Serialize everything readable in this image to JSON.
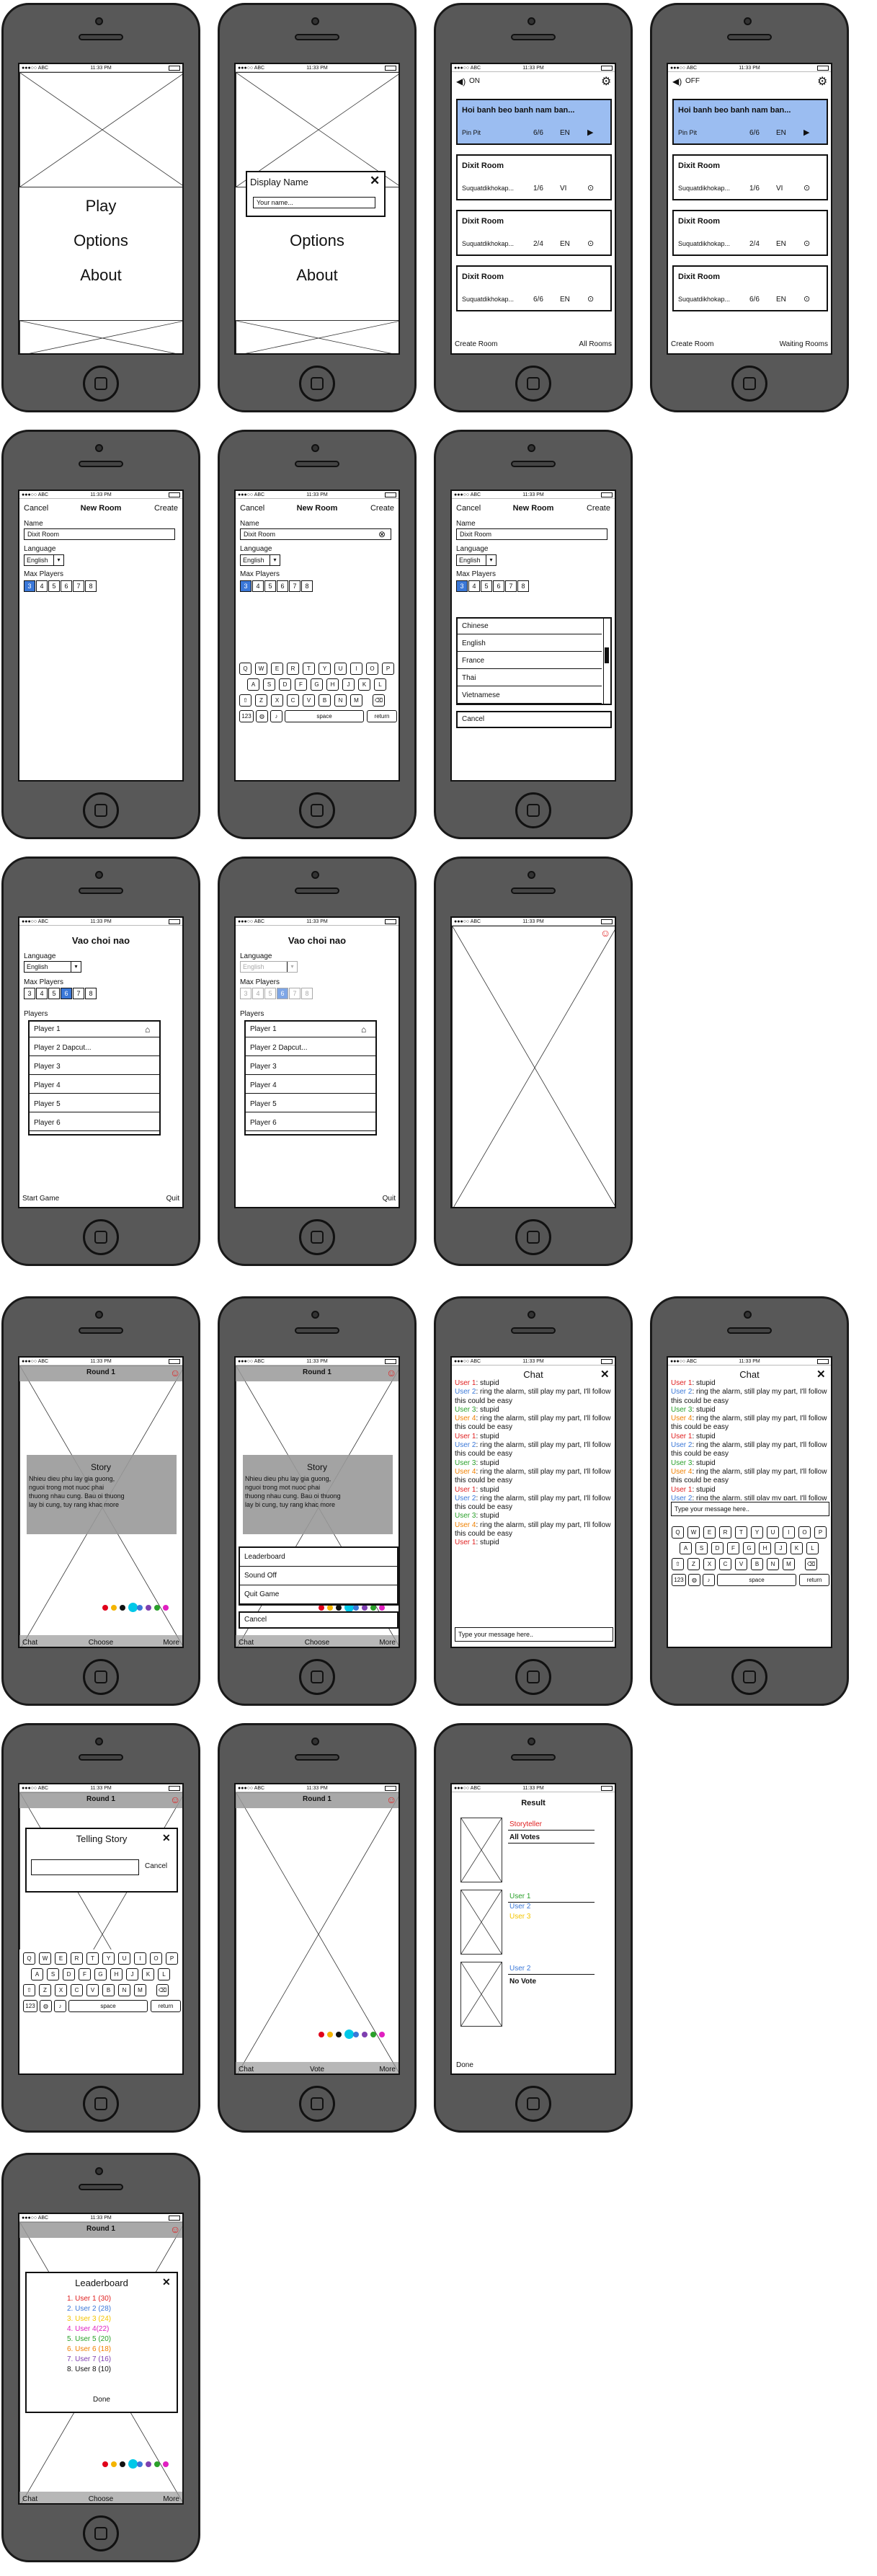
{
  "status": {
    "carrier": "●●●○○ ABC",
    "time": "11:33 PM"
  },
  "home": {
    "play": "Play",
    "options": "Options",
    "about": "About"
  },
  "display_name": {
    "title": "Display Name",
    "placeholder": "Your name..."
  },
  "rooms": {
    "sound_on": "ON",
    "sound_off": "OFF",
    "items": [
      {
        "name": "Hoi banh beo banh nam ban...",
        "owner": "Pin Pit",
        "count": "6/6",
        "lang": "EN",
        "state": "▶"
      },
      {
        "name": "Dixit Room",
        "owner": "Suquatdikhokap...",
        "count": "1/6",
        "lang": "VI",
        "state": "⊙"
      },
      {
        "name": "Dixit Room",
        "owner": "Suquatdikhokap...",
        "count": "2/4",
        "lang": "EN",
        "state": "⊙"
      },
      {
        "name": "Dixit Room",
        "owner": "Suquatdikhokap...",
        "count": "6/6",
        "lang": "EN",
        "state": "⊙"
      }
    ],
    "create_room": "Create Room",
    "all_rooms": "All Rooms",
    "waiting_rooms": "Waiting Rooms"
  },
  "new_room": {
    "cancel": "Cancel",
    "title": "New Room",
    "create": "Create",
    "name_label": "Name",
    "name_value": "Dixit Room",
    "language_label": "Language",
    "language_value": "English",
    "max_players_label": "Max Players",
    "max_options": [
      "3",
      "4",
      "5",
      "6",
      "7",
      "8"
    ],
    "languages": [
      "Chinese",
      "English",
      "France",
      "Thai",
      "Vietnamese"
    ],
    "picker_cancel": "Cancel"
  },
  "keyboard": {
    "row1": [
      "Q",
      "W",
      "E",
      "R",
      "T",
      "Y",
      "U",
      "I",
      "O",
      "P"
    ],
    "row2": [
      "A",
      "S",
      "D",
      "F",
      "G",
      "H",
      "J",
      "K",
      "L"
    ],
    "row3": [
      "Z",
      "X",
      "C",
      "V",
      "B",
      "N",
      "M"
    ],
    "num": "123",
    "space": "space",
    "ret": "return"
  },
  "lobby": {
    "title": "Vao choi nao",
    "language_label": "Language",
    "language_value": "English",
    "max_players_label": "Max Players",
    "players_label": "Players",
    "players": [
      "Player 1",
      "Player 2 Dapcut...",
      "Player 3",
      "Player 4",
      "Player 5",
      "Player 6"
    ],
    "start": "Start Game",
    "quit": "Quit"
  },
  "game": {
    "round": "Round 1",
    "story_title": "Story",
    "story_text": [
      "Nhieu dieu phu lay gia guong,",
      "nguoi trong mot nuoc phai",
      "thuong nhau cung. Bau oi thuong",
      "lay bi cung, tuy rang khac more"
    ],
    "more_link": "more",
    "chat": "Chat",
    "choose": "Choose",
    "more": "More",
    "vote": "Vote",
    "menu": [
      "Leaderboard",
      "Sound Off",
      "Quit Game"
    ],
    "menu_cancel": "Cancel",
    "dot_colors": [
      "#e0001a",
      "#f4b400",
      "#111111",
      "#00c8e8",
      "#3b78d8",
      "#7e3fb0",
      "#2aa02a",
      "#e020c0"
    ]
  },
  "chat": {
    "title": "Chat",
    "close": "✕",
    "messages": [
      {
        "user": "User 1",
        "color": "#e02020",
        "text": "stupid"
      },
      {
        "user": "User 2",
        "color": "#3b78d8",
        "text": "ring the alarm, still play my part, I'll follow this could be easy"
      },
      {
        "user": "User 3",
        "color": "#2aa02a",
        "text": "stupid"
      },
      {
        "user": "User 4",
        "color": "#f08000",
        "text": "ring the alarm, still play my part, I'll follow this could be easy"
      },
      {
        "user": "User 1",
        "color": "#e02020",
        "text": "stupid"
      },
      {
        "user": "User 2",
        "color": "#3b78d8",
        "text": "ring the alarm, still play my part, I'll follow this could be easy"
      },
      {
        "user": "User 3",
        "color": "#2aa02a",
        "text": "stupid"
      },
      {
        "user": "User 4",
        "color": "#f08000",
        "text": "ring the alarm, still play my part, I'll follow this could be easy"
      },
      {
        "user": "User 1",
        "color": "#e02020",
        "text": "stupid"
      },
      {
        "user": "User 2",
        "color": "#3b78d8",
        "text": "ring the alarm, still play my part, I'll follow this could be easy"
      },
      {
        "user": "User 3",
        "color": "#2aa02a",
        "text": "stupid"
      },
      {
        "user": "User 4",
        "color": "#f08000",
        "text": "ring the alarm, still play my part, I'll follow this could be easy"
      },
      {
        "user": "User 1",
        "color": "#e02020",
        "text": "stupid"
      }
    ],
    "placeholder": "Type your message here.."
  },
  "telling": {
    "title": "Telling Story",
    "cancel": "Cancel"
  },
  "result": {
    "title": "Result",
    "storyteller": "Storyteller",
    "all_votes": "All Votes",
    "voters": [
      {
        "name": "User 1",
        "color": "#2aa02a"
      },
      {
        "name": "User 2",
        "color": "#3b78d8"
      },
      {
        "name": "User 3",
        "color": "#f4c400"
      }
    ],
    "user2": "User 2",
    "no_vote": "No Vote",
    "done": "Done"
  },
  "leaderboard": {
    "title": "Leaderboard",
    "done": "Done",
    "entries": [
      {
        "text": "1. User 1 (30)",
        "color": "#e02020"
      },
      {
        "text": "2. User 2 (28)",
        "color": "#3b78d8"
      },
      {
        "text": "3. User 3 (24)",
        "color": "#f4c400"
      },
      {
        "text": "4. User 4(22)",
        "color": "#e020c0"
      },
      {
        "text": "5. User 5 (20)",
        "color": "#2aa02a"
      },
      {
        "text": "6. User 6 (18)",
        "color": "#f08000"
      },
      {
        "text": "7. User 7 (16)",
        "color": "#7e3fb0"
      },
      {
        "text": "8. User 8 (10)",
        "color": "#111111"
      }
    ]
  }
}
